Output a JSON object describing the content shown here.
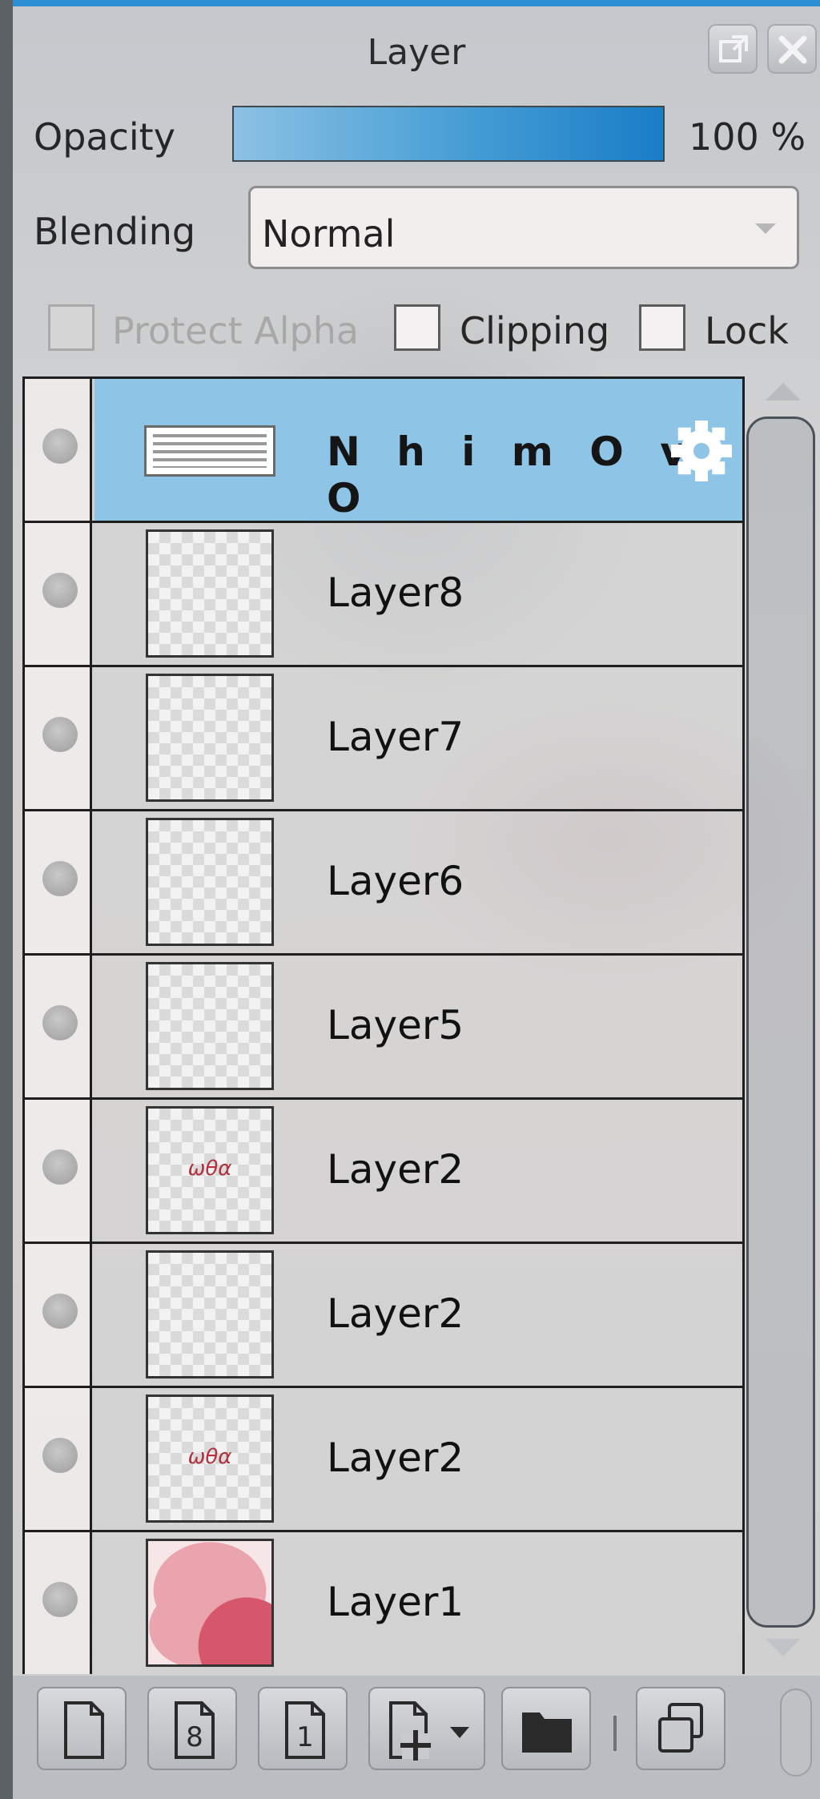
{
  "window": {
    "title": "Layer",
    "accent_color": "#2c8fd3",
    "popout_icon": "popout-icon",
    "close_icon": "close-icon"
  },
  "opacity": {
    "label": "Opacity",
    "value": 100,
    "value_text": "100 %"
  },
  "blending": {
    "label": "Blending",
    "selected": "Normal"
  },
  "options": {
    "protect_alpha": {
      "label": "Protect Alpha",
      "checked": false,
      "disabled": true
    },
    "clipping": {
      "label": "Clipping",
      "checked": false,
      "disabled": false
    },
    "lock": {
      "label": "Lock",
      "checked": false,
      "disabled": false
    }
  },
  "layers": [
    {
      "name": "N h i m O v O",
      "active": true,
      "thumb": "banner",
      "thumb_text": ""
    },
    {
      "name": "Layer8",
      "active": false,
      "thumb": "transparent",
      "thumb_text": ""
    },
    {
      "name": "Layer7",
      "active": false,
      "thumb": "transparent",
      "thumb_text": ""
    },
    {
      "name": "Layer6",
      "active": false,
      "thumb": "transparent",
      "thumb_text": ""
    },
    {
      "name": "Layer5",
      "active": false,
      "thumb": "transparent",
      "thumb_text": ""
    },
    {
      "name": "Layer2",
      "active": false,
      "thumb": "transparent",
      "thumb_text": "ωθα"
    },
    {
      "name": "Layer2",
      "active": false,
      "thumb": "transparent",
      "thumb_text": ""
    },
    {
      "name": "Layer2",
      "active": false,
      "thumb": "transparent",
      "thumb_text": "ωθα"
    },
    {
      "name": "Layer1",
      "active": false,
      "thumb": "pink",
      "thumb_text": ""
    }
  ],
  "active_layer_color": "#8ec4e6",
  "toolbar": {
    "buttons": [
      {
        "name": "new-layer-button",
        "icon": "page-icon",
        "glyph": ""
      },
      {
        "name": "new-8bit-layer-button",
        "icon": "page-8-icon",
        "glyph": "8"
      },
      {
        "name": "new-1bit-layer-button",
        "icon": "page-1-icon",
        "glyph": "1"
      },
      {
        "name": "add-layer-menu-button",
        "icon": "page-plus-dropdown-icon",
        "glyph": ""
      },
      {
        "name": "new-folder-button",
        "icon": "folder-icon",
        "glyph": ""
      },
      {
        "name": "duplicate-layer-button",
        "icon": "duplicate-icon",
        "glyph": ""
      }
    ]
  }
}
